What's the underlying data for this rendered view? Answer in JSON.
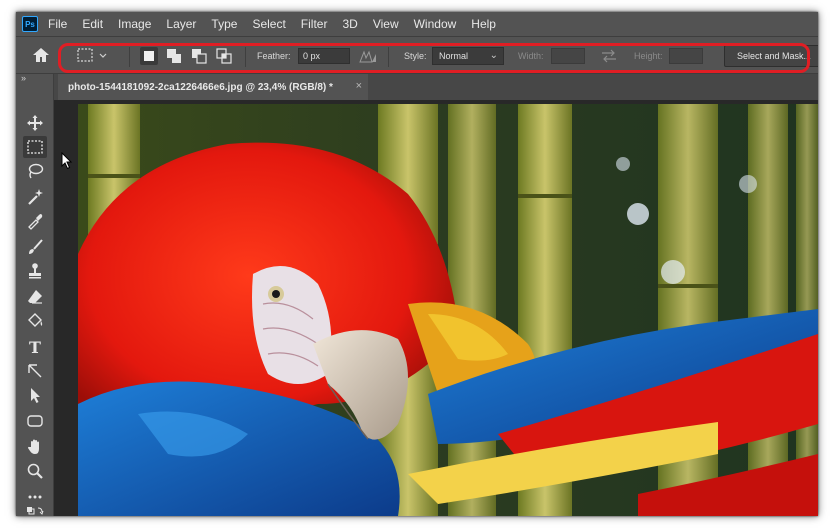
{
  "app": {
    "logo_text": "Ps",
    "menu": [
      "File",
      "Edit",
      "Image",
      "Layer",
      "Type",
      "Select",
      "Filter",
      "3D",
      "View",
      "Window",
      "Help"
    ]
  },
  "options_bar": {
    "feather_label": "Feather:",
    "feather_value": "0 px",
    "style_label": "Style:",
    "style_value": "Normal",
    "width_label": "Width:",
    "height_label": "Height:",
    "select_and_mask_label": "Select and Mask...",
    "highlight_color": "#e01e24"
  },
  "toolbar": {
    "collapse_glyph": "»",
    "type_tool_glyph": "T",
    "active_tool": "rectangular-marquee"
  },
  "document": {
    "tab_title": "photo-1544181092-2ca1226466e6.jpg @ 23,4% (RGB/8) *",
    "close_glyph": "×"
  },
  "colors": {
    "ui_background": "#535353",
    "canvas_background": "#282828",
    "accent_blue": "#31a8ff"
  }
}
